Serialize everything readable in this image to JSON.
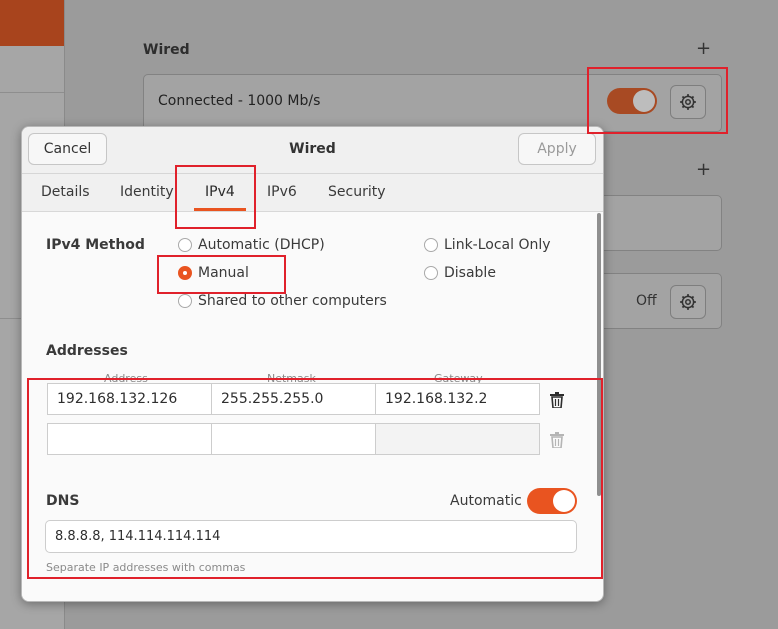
{
  "background": {
    "wired_heading": "Wired",
    "connection_status": "Connected - 1000 Mb/s",
    "second_status": "Off",
    "plus_symbol": "+"
  },
  "dialog": {
    "title": "Wired",
    "cancel_label": "Cancel",
    "apply_label": "Apply",
    "tabs": [
      "Details",
      "Identity",
      "IPv4",
      "IPv6",
      "Security"
    ],
    "active_tab": "IPv4",
    "ipv4_method_label": "IPv4 Method",
    "methods": {
      "automatic": "Automatic (DHCP)",
      "manual": "Manual",
      "shared": "Shared to other computers",
      "link_local": "Link-Local Only",
      "disable": "Disable"
    },
    "selected_method": "Manual",
    "addresses_label": "Addresses",
    "columns": [
      "Address",
      "Netmask",
      "Gateway"
    ],
    "rows": [
      [
        "192.168.132.126",
        "255.255.255.0",
        "192.168.132.2"
      ],
      [
        "",
        "",
        ""
      ]
    ],
    "dns_label": "DNS",
    "dns_automatic_label": "Automatic",
    "dns_automatic_on": true,
    "dns_value": "8.8.8.8, 114.114.114.114",
    "dns_hint": "Separate IP addresses with commas"
  },
  "colors": {
    "accent": "#e95420",
    "highlight_box": "#e0212b"
  },
  "icons": [
    "gear-icon",
    "trash-icon",
    "plus-icon"
  ]
}
